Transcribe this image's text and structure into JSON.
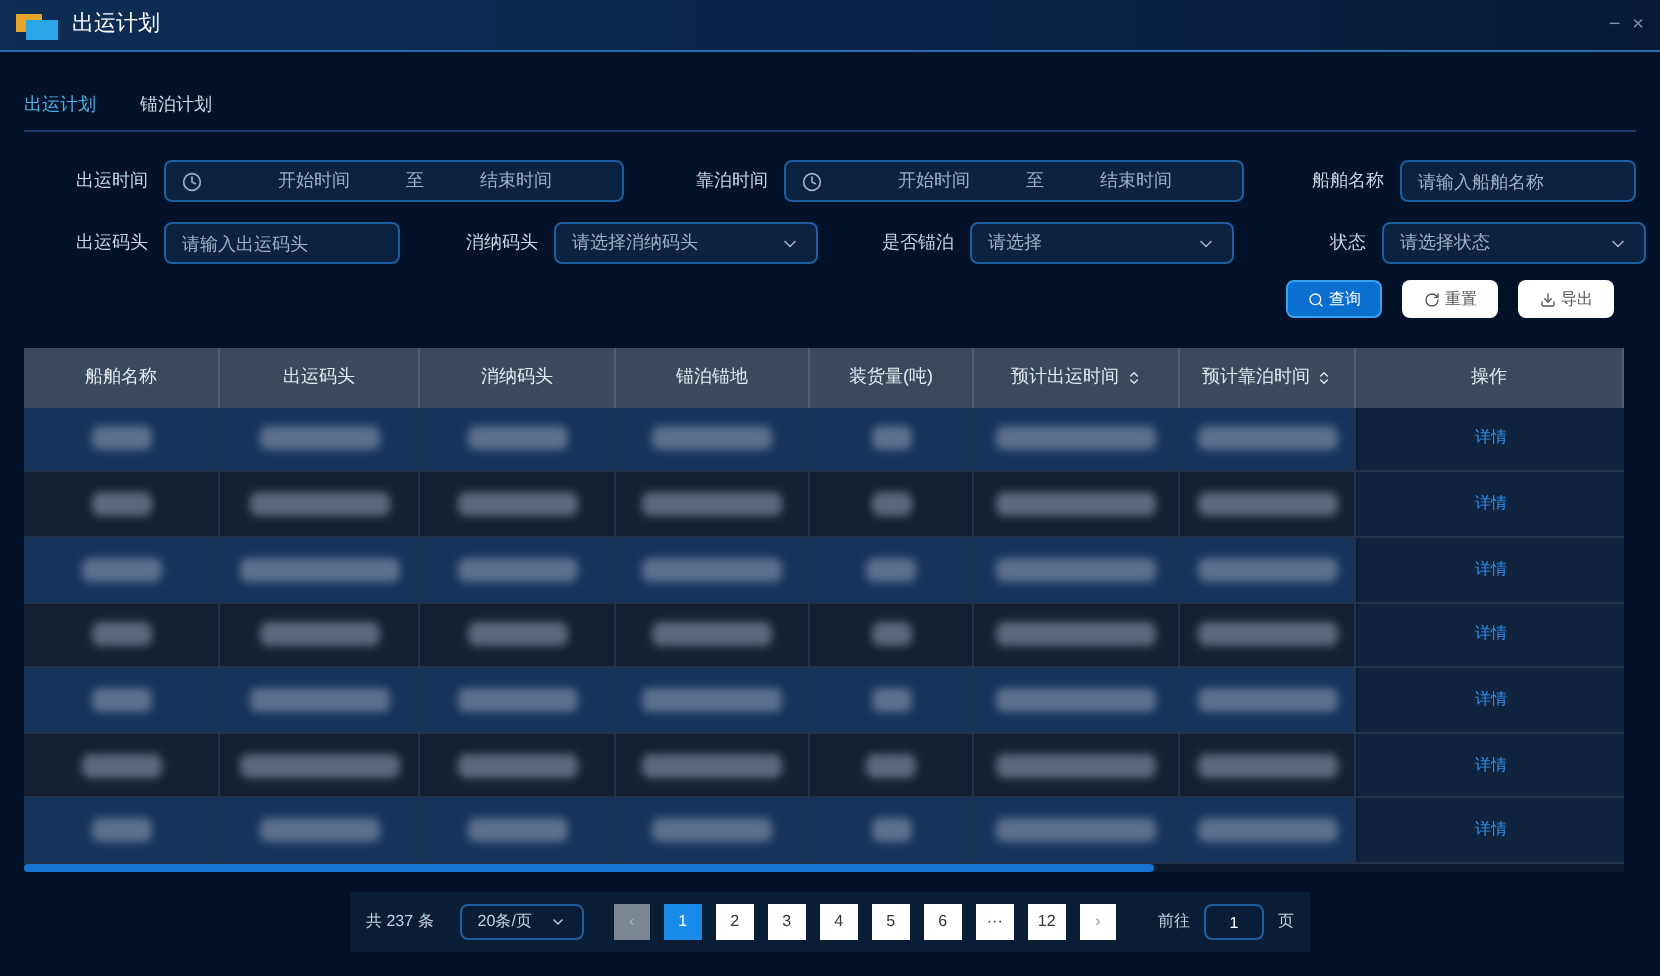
{
  "window": {
    "title": "出运计划",
    "controls": [
      "−",
      "×"
    ]
  },
  "tabs": [
    {
      "label": "出运计划",
      "selected": true
    },
    {
      "label": "锚泊计划",
      "selected": false
    }
  ],
  "filters": [
    {
      "kind": "range",
      "label": "出运时间",
      "start": "开始时间",
      "sep": "至",
      "end": "结束时间"
    },
    {
      "kind": "range",
      "label": "靠泊时间",
      "start": "开始时间",
      "sep": "至",
      "end": "结束时间"
    },
    {
      "kind": "input",
      "label": "船舶名称",
      "placeholder": "请输入船舶名称"
    },
    {
      "kind": "input",
      "label": "出运码头",
      "placeholder": "请输入出运码头"
    },
    {
      "kind": "select",
      "label": "消纳码头",
      "placeholder": "请选择消纳码头"
    },
    {
      "kind": "select",
      "label": "是否锚泊",
      "placeholder": "请选择"
    },
    {
      "kind": "select",
      "label": "状态",
      "placeholder": "请选择状态"
    }
  ],
  "actions": [
    {
      "kind": "primary",
      "label": "查询"
    },
    {
      "kind": "reset",
      "label": "重置"
    },
    {
      "kind": "export",
      "label": "导出"
    }
  ],
  "table": {
    "columns": [
      {
        "label": "船舶名称",
        "sortable": false
      },
      {
        "label": "出运码头",
        "sortable": false
      },
      {
        "label": "消纳码头",
        "sortable": false
      },
      {
        "label": "锚泊锚地",
        "sortable": false
      },
      {
        "label": "装货量(吨)",
        "sortable": false
      },
      {
        "label": "预计出运时间",
        "sortable": true
      },
      {
        "label": "预计靠泊时间",
        "sortable": true
      },
      {
        "label": "操作",
        "sortable": false
      }
    ],
    "rows": [
      {
        "action": "详情"
      },
      {
        "action": "详情"
      },
      {
        "action": "详情"
      },
      {
        "action": "详情"
      },
      {
        "action": "详情"
      },
      {
        "action": "详情"
      },
      {
        "action": "详情"
      }
    ]
  },
  "pagination": {
    "total": "共 237 条",
    "page_size": "20条/页",
    "pages": [
      {
        "label": "1",
        "selected": true
      },
      {
        "label": "2",
        "selected": false
      },
      {
        "label": "3",
        "selected": false
      },
      {
        "label": "4",
        "selected": false
      },
      {
        "label": "5",
        "selected": false
      },
      {
        "label": "6",
        "selected": false
      },
      {
        "label": "···",
        "selected": false
      },
      {
        "label": "12",
        "selected": false
      }
    ],
    "prev_disabled": true,
    "next": "›",
    "prev": "‹",
    "goto_label": "前往",
    "goto_value": "1",
    "goto_suffix": "页"
  }
}
